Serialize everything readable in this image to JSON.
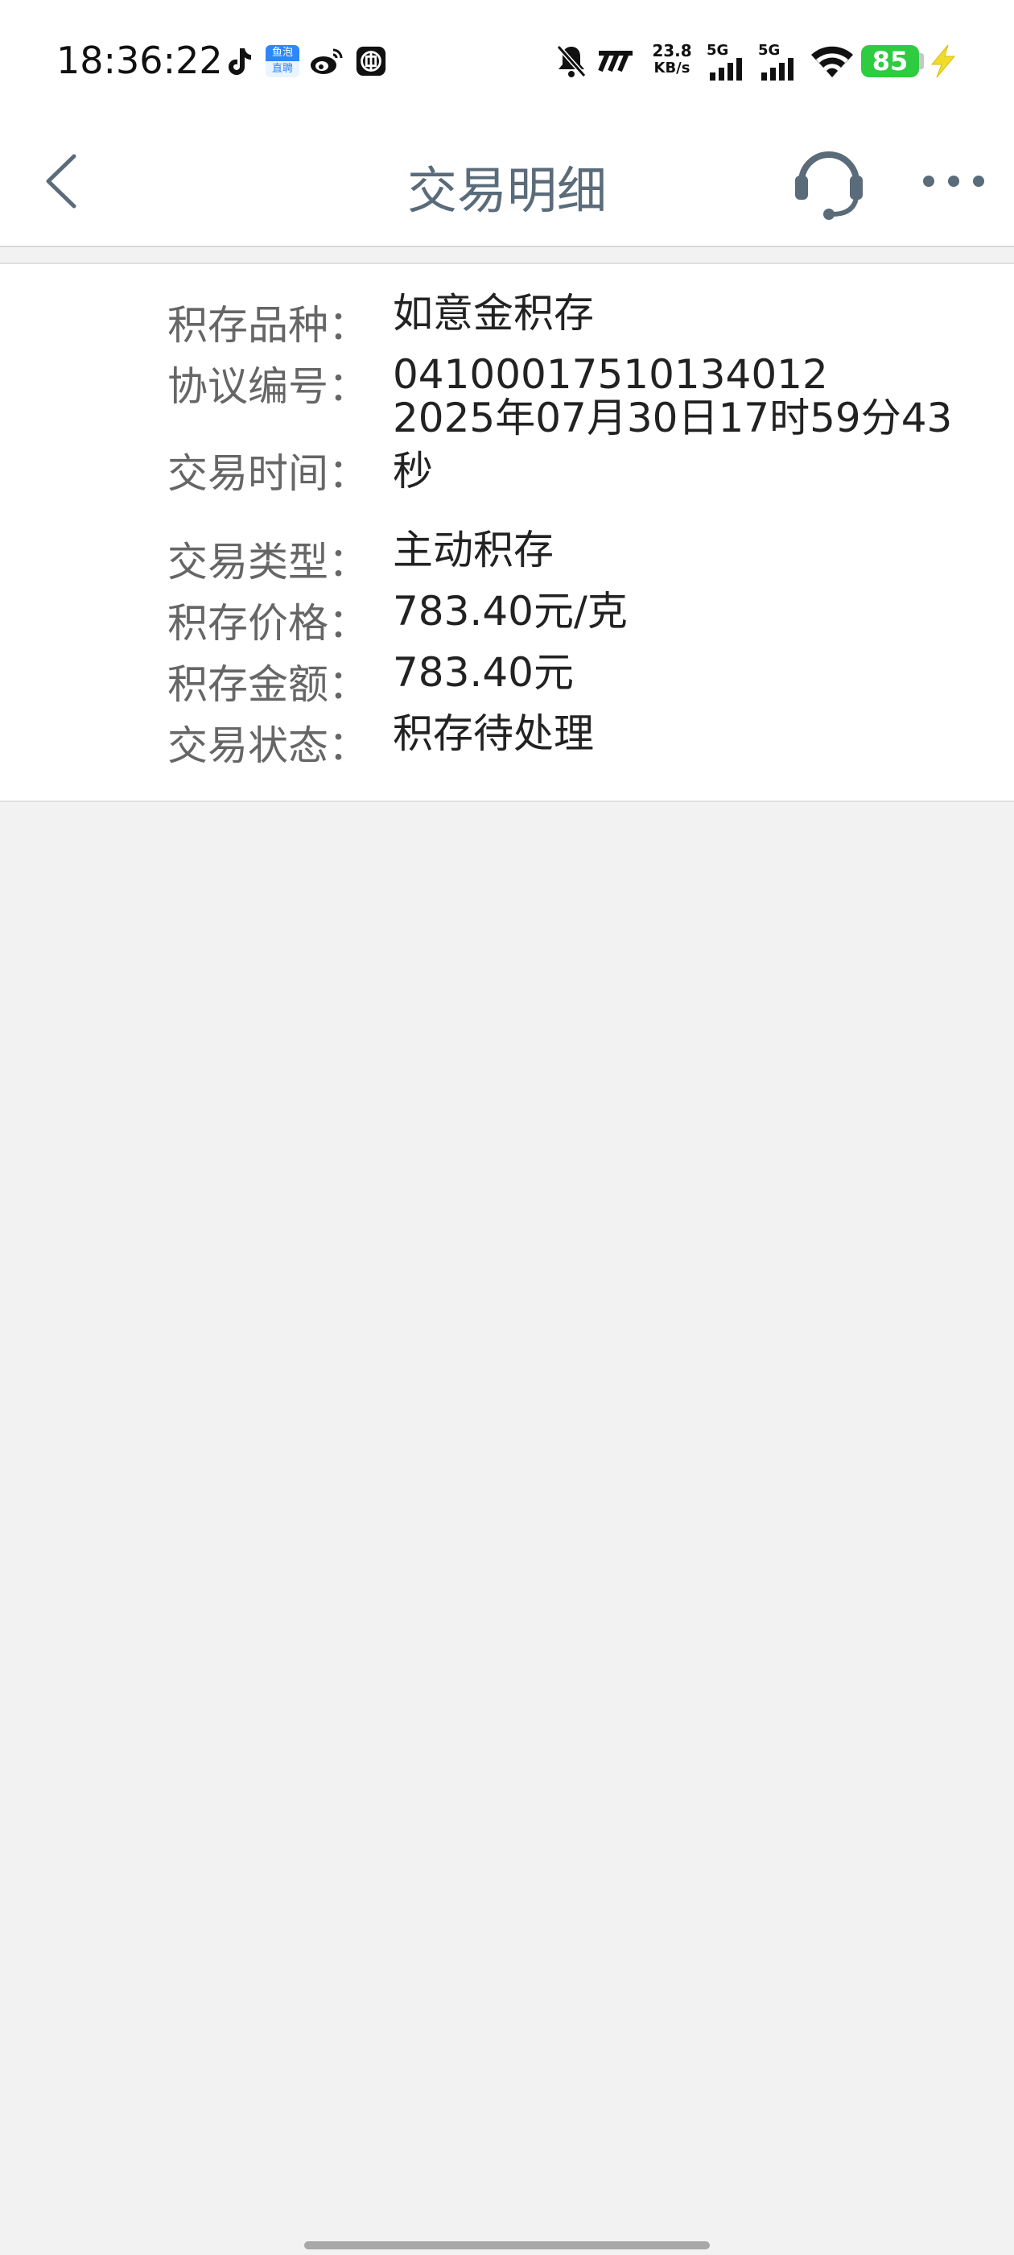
{
  "status_bar": {
    "time": "18:36:22",
    "app_badge": "鱼泡直聘",
    "net_speed_value": "23.8",
    "net_speed_unit": "KB/s",
    "signal_1": "5G",
    "signal_2": "5G",
    "battery": "85",
    "icons": [
      "tiktok-icon",
      "yupao-app-icon",
      "weibo-icon",
      "bank-app-icon",
      "mute-bell-icon",
      "nfc-icon",
      "signal-icon",
      "wifi-icon",
      "battery-icon",
      "charging-icon"
    ]
  },
  "header": {
    "title": "交易明细"
  },
  "details": {
    "product": {
      "label": "积存品种：",
      "value": "如意金积存"
    },
    "agreement_no": {
      "label": "协议编号：",
      "value": "04100017510134012"
    },
    "trade_time": {
      "label": "交易时间：",
      "value": "2025年07月30日17时59分43秒"
    },
    "trade_type": {
      "label": "交易类型：",
      "value": "主动积存"
    },
    "price": {
      "label": "积存价格：",
      "value": "783.40元/克"
    },
    "amount": {
      "label": "积存金额：",
      "value": "783.40元"
    },
    "status": {
      "label": "交易状态：",
      "value": "积存待处理"
    }
  }
}
